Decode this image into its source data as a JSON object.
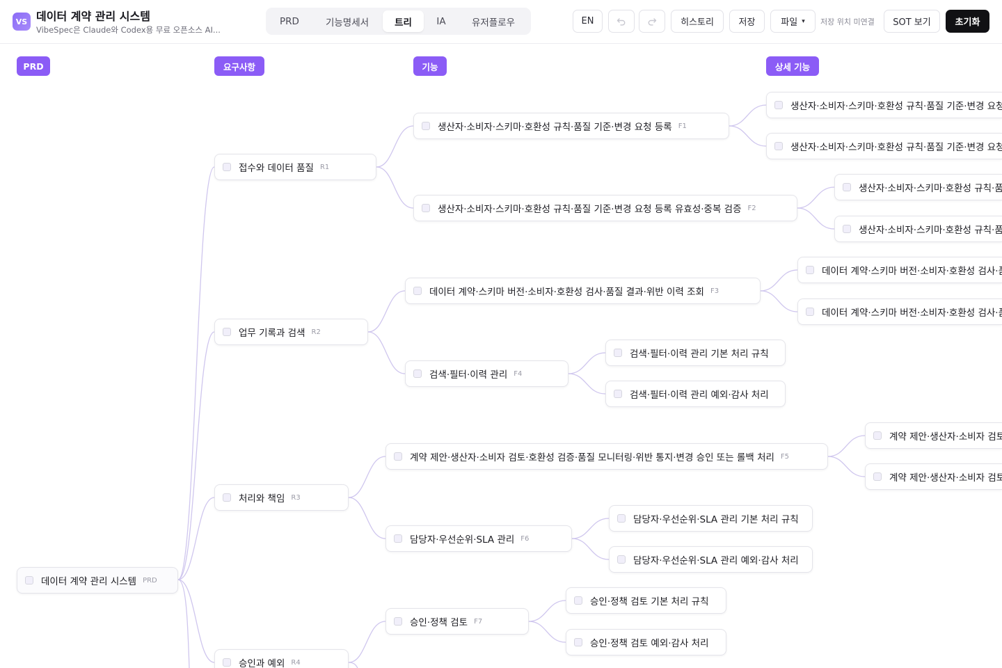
{
  "app": {
    "logo_text": "VS",
    "title": "데이터 계약 관리 시스템",
    "subtitle": "VibeSpec은 Claude와 Codex용 무료 오픈소스 AI..."
  },
  "tabs": [
    {
      "label": "PRD",
      "active": false
    },
    {
      "label": "기능명세서",
      "active": false
    },
    {
      "label": "트리",
      "active": true
    },
    {
      "label": "IA",
      "active": false
    },
    {
      "label": "유저플로우",
      "active": false
    }
  ],
  "toolbar": {
    "lang": "EN",
    "undo_icon": "undo-icon",
    "redo_icon": "redo-icon",
    "history": "히스토리",
    "save": "저장",
    "file": "파일",
    "file_chevron": "▾",
    "save_location_status": "저장 위치 미연결",
    "sot": "SOT 보기",
    "reset": "초기화"
  },
  "columns": {
    "prd": "PRD",
    "requirements": "요구사항",
    "features": "기능",
    "details": "상세 기능"
  },
  "tree": {
    "root": {
      "label": "데이터 계약 관리 시스템",
      "code": "PRD"
    },
    "requirements": [
      {
        "label": "접수와 데이터 품질",
        "code": "R1"
      },
      {
        "label": "업무 기록과 검색",
        "code": "R2"
      },
      {
        "label": "처리와 책임",
        "code": "R3"
      },
      {
        "label": "승인과 예외",
        "code": "R4"
      }
    ],
    "features": [
      {
        "label": "생산자·소비자·스키마·호환성 규칙·품질 기준·변경 요청 등록",
        "code": "F1"
      },
      {
        "label": "생산자·소비자·스키마·호환성 규칙·품질 기준·변경 요청 등록 유효성·중복 검증",
        "code": "F2"
      },
      {
        "label": "데이터 계약·스키마 버전·소비자·호환성 검사·품질 결과·위반 이력 조회",
        "code": "F3"
      },
      {
        "label": "검색·필터·이력 관리",
        "code": "F4"
      },
      {
        "label": "계약 제안·생산자·소비자 검토·호환성 검증·품질 모니터링·위반 통지·변경 승인 또는 롤백 처리",
        "code": "F5"
      },
      {
        "label": "담당자·우선순위·SLA 관리",
        "code": "F6"
      },
      {
        "label": "승인·정책 검토",
        "code": "F7"
      }
    ],
    "details": [
      {
        "label": "생산자·소비자·스키마·호환성 규칙·품질 기준·변경 요청"
      },
      {
        "label": "생산자·소비자·스키마·호환성 규칙·품질 기준·변경 요청"
      },
      {
        "label": "생산자·소비자·스키마·호환성 규칙·품질"
      },
      {
        "label": "생산자·소비자·스키마·호환성 규칙·품질"
      },
      {
        "label": "데이터 계약·스키마 버전·소비자·호환성 검사·품"
      },
      {
        "label": "데이터 계약·스키마 버전·소비자·호환성 검사·품"
      },
      {
        "label": "검색·필터·이력 관리 기본 처리 규칙"
      },
      {
        "label": "검색·필터·이력 관리 예외·감사 처리"
      },
      {
        "label": "계약 제안·생산자·소비자 검토"
      },
      {
        "label": "계약 제안·생산자·소비자 검토"
      },
      {
        "label": "담당자·우선순위·SLA 관리 기본 처리 규칙"
      },
      {
        "label": "담당자·우선순위·SLA 관리 예외·감사 처리"
      },
      {
        "label": "승인·정책 검토 기본 처리 규칙"
      },
      {
        "label": "승인·정책 검토 예외·감사 처리"
      }
    ]
  },
  "colors": {
    "accent": "#8b5cf6",
    "edge": "#cfc6ee"
  }
}
